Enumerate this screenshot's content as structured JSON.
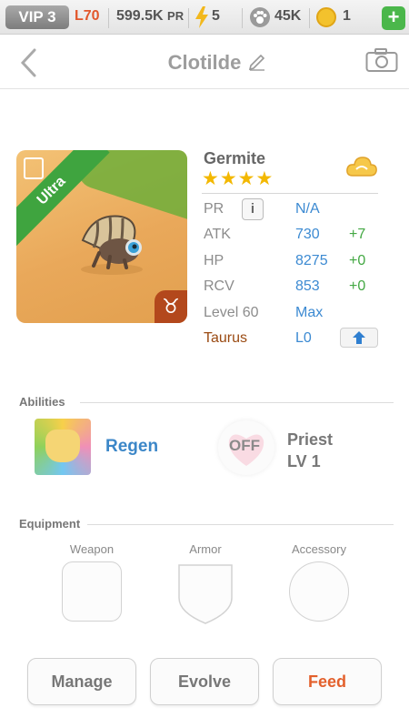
{
  "status_bar": {
    "vip": "VIP 3",
    "level": "L70",
    "pr": "599.5K",
    "pr_unit": "PR",
    "energy": "5",
    "paws": "45K",
    "coins": "1",
    "add_symbol": "+"
  },
  "header": {
    "title": "Clotilde"
  },
  "monster": {
    "rarity": "Ultra",
    "zodiac_symbol": "♉",
    "name": "Germite",
    "stars": "★★★★",
    "star_count": 4,
    "element_icon": "cloud-icon"
  },
  "stats": {
    "pr": {
      "label": "PR",
      "info": "i",
      "value": "N/A"
    },
    "atk": {
      "label": "ATK",
      "value": "730",
      "bonus": "+7"
    },
    "hp": {
      "label": "HP",
      "value": "8275",
      "bonus": "+0"
    },
    "rcv": {
      "label": "RCV",
      "value": "853",
      "bonus": "+0"
    },
    "level": {
      "label": "Level 60",
      "value": "Max"
    },
    "zodiac": {
      "label": "Taurus",
      "value": "L0"
    }
  },
  "abilities": {
    "section_title": "Abilities",
    "active": {
      "name": "Regen"
    },
    "leader": {
      "state": "OFF",
      "class": "Priest",
      "level": "LV 1"
    }
  },
  "equipment": {
    "section_title": "Equipment",
    "slots": [
      "Weapon",
      "Armor",
      "Accessory"
    ]
  },
  "actions": {
    "manage": "Manage",
    "evolve": "Evolve",
    "feed": "Feed"
  },
  "colors": {
    "accent_blue": "#3c8ad2",
    "bonus_green": "#43a843",
    "feed_orange": "#e3602c",
    "zodiac_brown": "#9a4a12"
  }
}
